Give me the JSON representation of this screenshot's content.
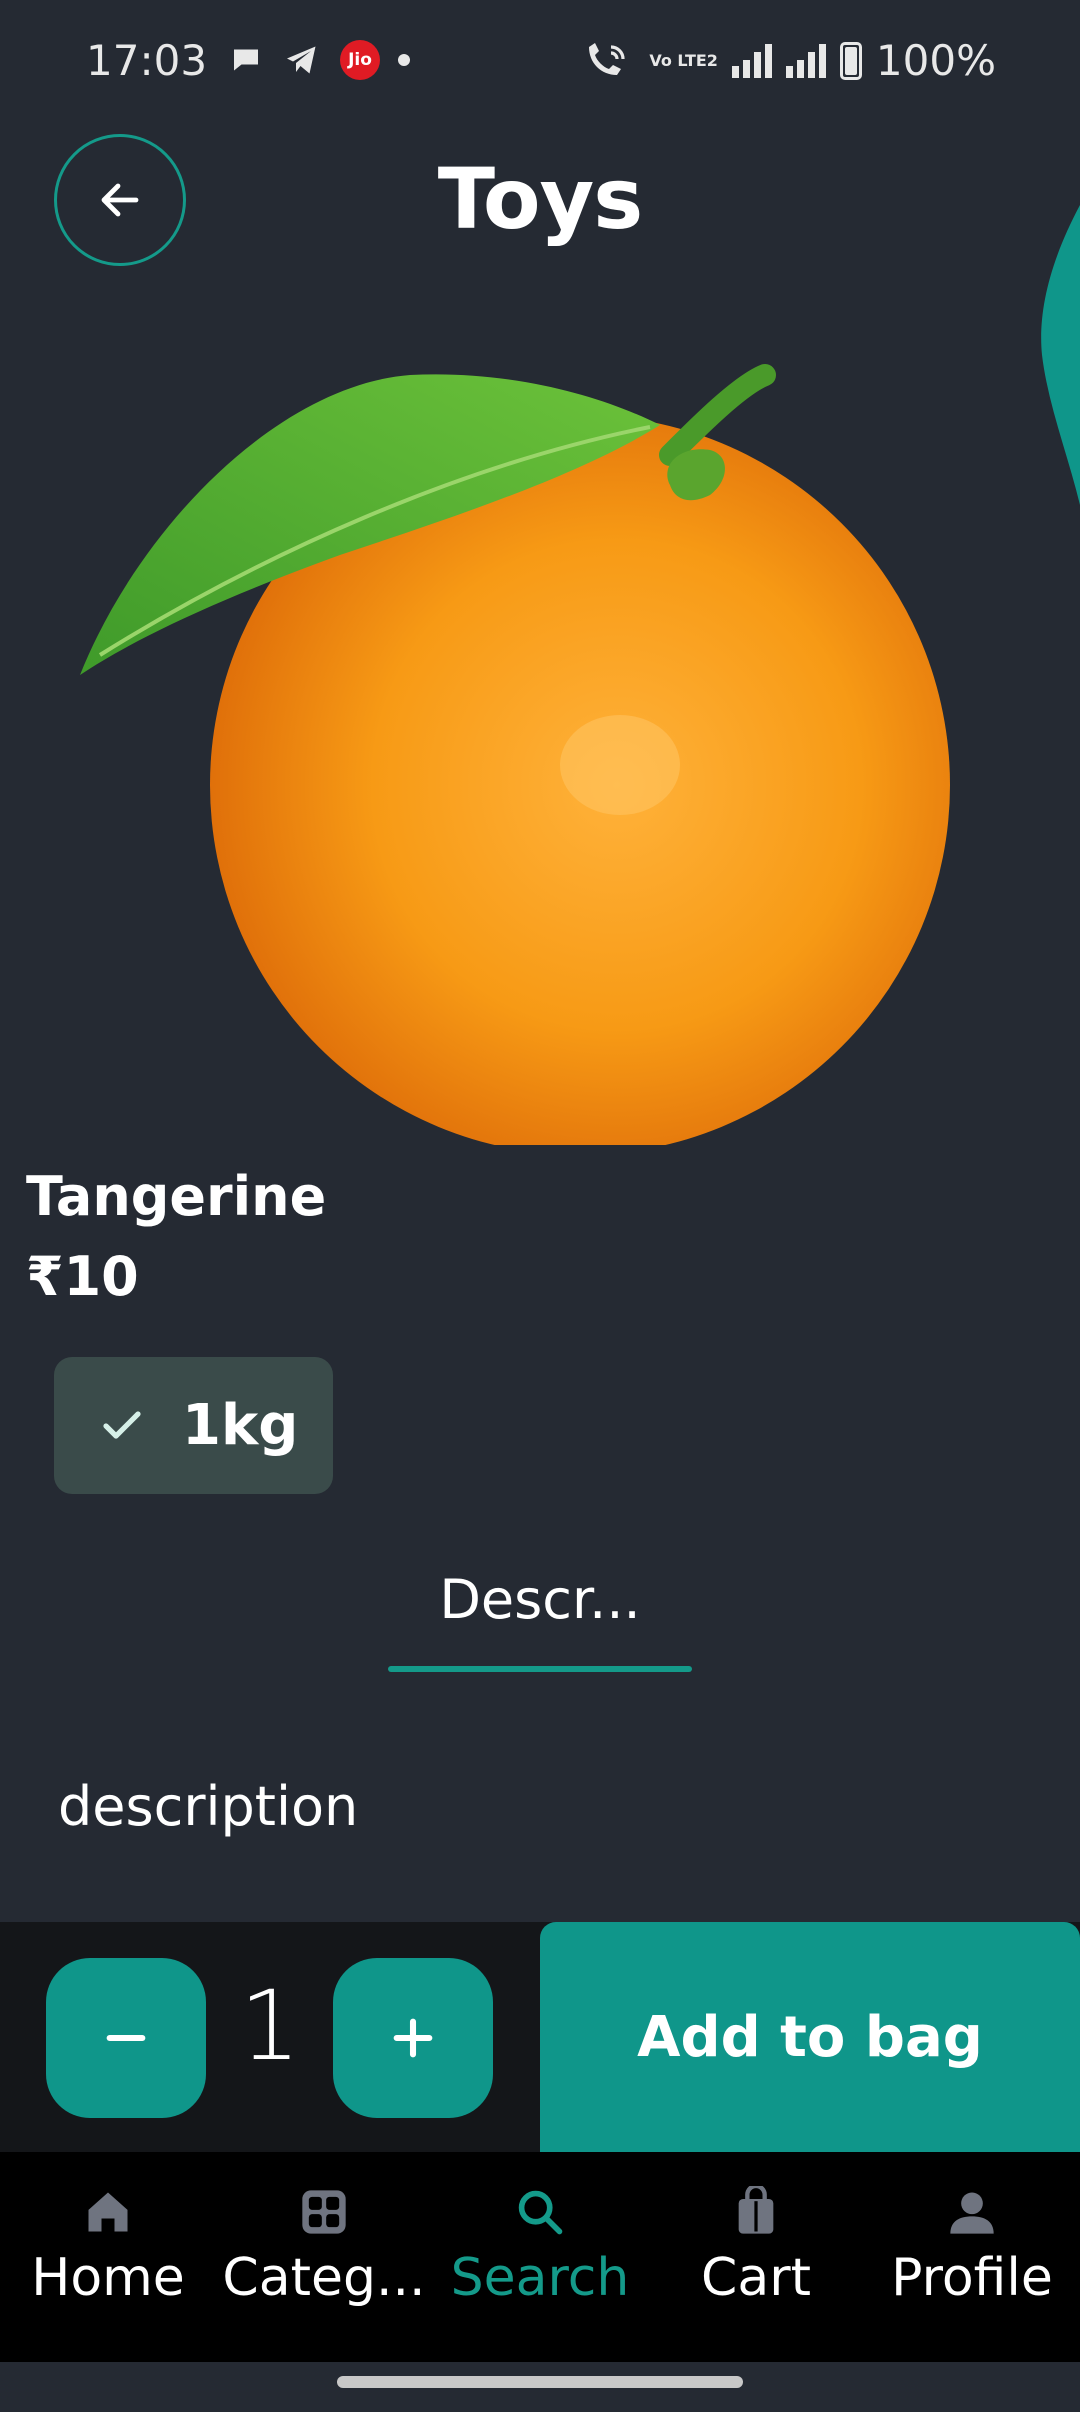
{
  "status_bar": {
    "time": "17:03",
    "battery": "100%",
    "network_badge": "Jio",
    "volte_label": "Vo LTE2"
  },
  "header": {
    "title": "Toys",
    "back_icon": "arrow-left-icon"
  },
  "product": {
    "name": "Tangerine",
    "price": "₹10",
    "image": "orange-fruit-image"
  },
  "variant": {
    "label": "1kg",
    "selected": true
  },
  "tabs": [
    {
      "label": "Descr...",
      "active": true
    }
  ],
  "description": "description",
  "cart_controls": {
    "quantity": "1",
    "add_label": "Add to bag"
  },
  "bottom_nav": [
    {
      "label": "Home",
      "icon": "home-icon",
      "active": false
    },
    {
      "label": "Categ...",
      "icon": "grid-icon",
      "active": false
    },
    {
      "label": "Search",
      "icon": "search-icon",
      "active": true
    },
    {
      "label": "Cart",
      "icon": "bag-icon",
      "active": false
    },
    {
      "label": "Profile",
      "icon": "person-icon",
      "active": false
    }
  ],
  "colors": {
    "background": "#252a33",
    "accent": "#0f968a",
    "chip": "#3a4b4a",
    "nav": "#000000"
  }
}
